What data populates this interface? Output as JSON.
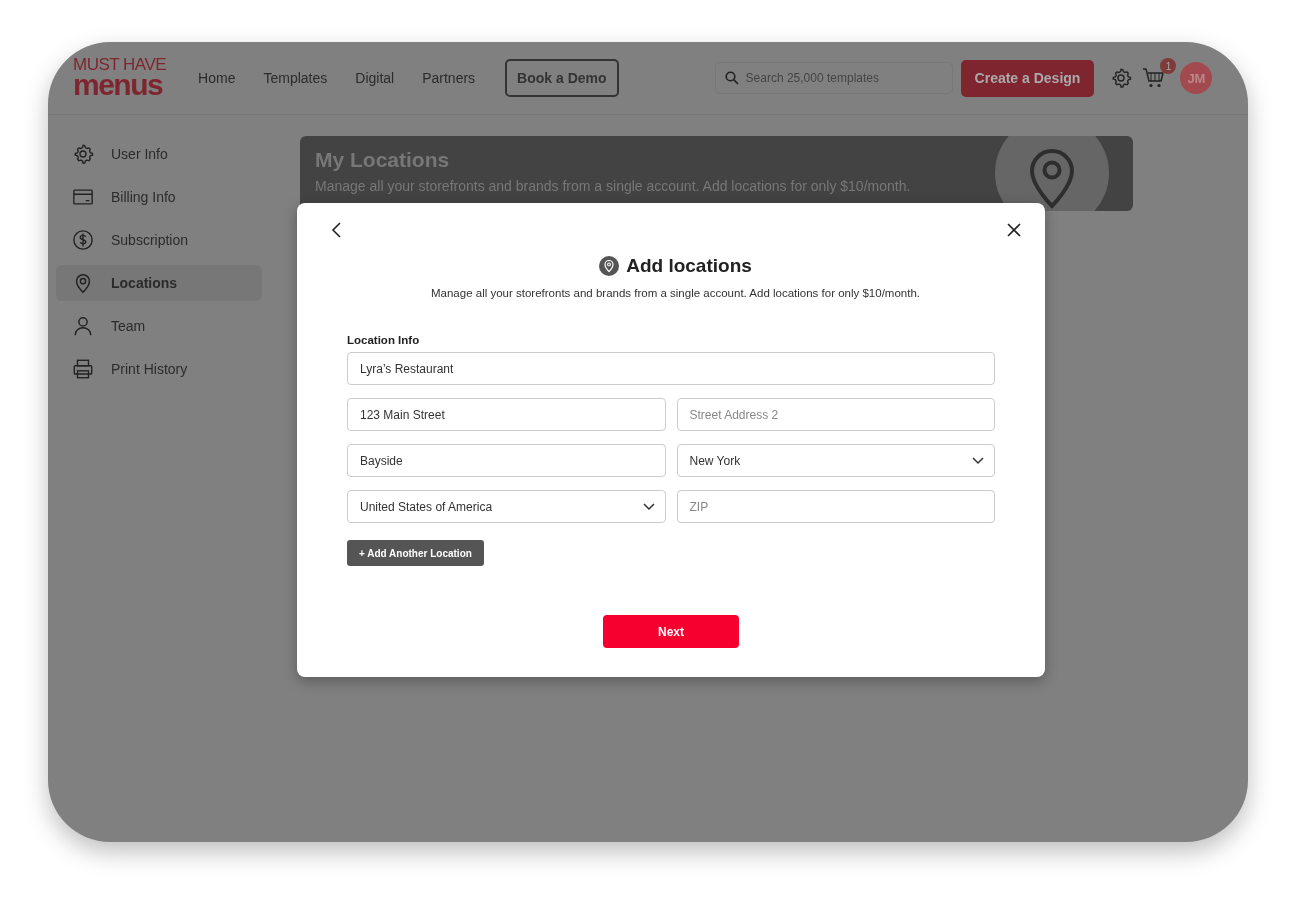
{
  "brand": {
    "line_1": "MUST HAVE",
    "line_2": "menus"
  },
  "nav": [
    {
      "label": "Home"
    },
    {
      "label": "Templates"
    },
    {
      "label": "Digital"
    },
    {
      "label": "Partners"
    }
  ],
  "demo_button": "Book a Demo",
  "search": {
    "placeholder": "Search 25,000 templates"
  },
  "create_button": "Create a Design",
  "cart": {
    "count": "1"
  },
  "avatar": {
    "initials": "JM"
  },
  "sidebar": {
    "items": [
      {
        "label": "User Info",
        "selected": false
      },
      {
        "label": "Billing Info",
        "selected": false
      },
      {
        "label": "Subscription",
        "selected": false
      },
      {
        "label": "Locations",
        "selected": true
      },
      {
        "label": "Team",
        "selected": false
      },
      {
        "label": "Print History",
        "selected": false
      }
    ]
  },
  "banner": {
    "title": "My Locations",
    "text": "Manage all your storefronts and brands from a single account. Add locations for only $10/month."
  },
  "modal": {
    "title": "Add locations",
    "subtitle": "Manage all your storefronts and brands from a single account. Add locations for only $10/month.",
    "section_label": "Location Info",
    "fields": [
      {
        "kind": "text",
        "value": "Lyra’s Restaurant"
      },
      {
        "kind": "text",
        "value": "123 Main Street"
      },
      {
        "kind": "text",
        "placeholder": "Street Address 2"
      },
      {
        "kind": "text",
        "value": "Bayside"
      },
      {
        "kind": "select",
        "value": "New York"
      },
      {
        "kind": "select",
        "value": "United States of America"
      },
      {
        "kind": "text",
        "placeholder": "ZIP"
      }
    ],
    "add_button": "+ Add Another Location",
    "next_button": "Next"
  }
}
